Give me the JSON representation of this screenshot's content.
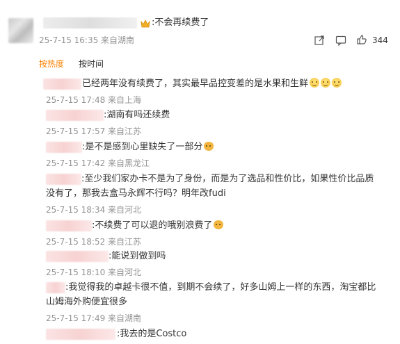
{
  "root_comment": {
    "text": ":不会再续费了",
    "meta": "25-7-15 16:35 来自湖南",
    "like_count": "344"
  },
  "tabs": {
    "hot": "按热度",
    "time": "按时间"
  },
  "replies": [
    {
      "text": "已经两年没有续费了，其实最早品控变差的是水果和生鲜",
      "meta": "25-7-15 17:48 来自上海"
    },
    {
      "text": ":湖南有吗还续费",
      "meta": "25-7-15 17:57 来自江苏"
    },
    {
      "text": ":是不是感到心里缺失了一部分",
      "meta": "25-7-15 17:42 来自黑龙江"
    },
    {
      "text": ":至少我们家办卡不是为了身份，而是为了选品和性价比，如果性价比品质",
      "text2": "没有了，那我去盒马永辉不行吗？明年改fudi",
      "meta": "25-7-15 18:34 来自河北"
    },
    {
      "text": ":不续费了可以退的哦别浪费了",
      "meta": "25-7-15 18:52 来自江苏"
    },
    {
      "text": ":能说到做到吗",
      "meta": "25-7-15 18:10 来自河北"
    },
    {
      "text": ":我觉得我的卓越卡很不值，到期不会续了，好多山姆上一样的东西，淘宝都比",
      "text2": "山姆海外购便宜很多",
      "meta": "25-7-15 17:49 来自湖南"
    },
    {
      "text": ":我去的是Costco"
    }
  ]
}
